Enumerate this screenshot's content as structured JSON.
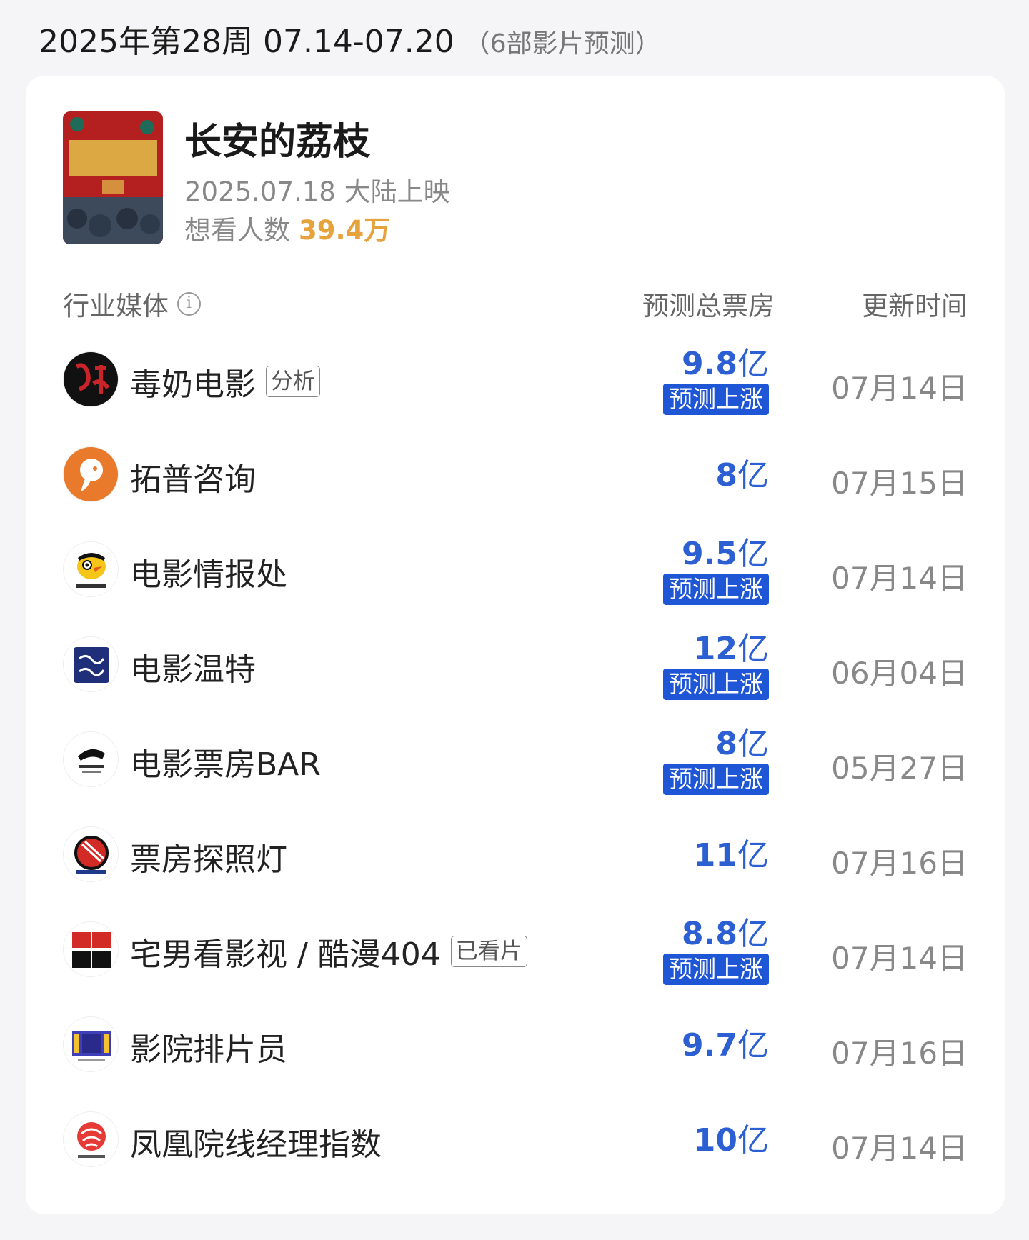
{
  "week": {
    "title": "2025年第28周 07.14-07.20",
    "subtitle": "（6部影片预测）"
  },
  "movie": {
    "title": "长安的荔枝",
    "release": "2025.07.18 大陆上映",
    "want_label": "想看人数",
    "want_count": "39.4万",
    "poster_icon": "movie-poster"
  },
  "table_header": {
    "media": "行业媒体",
    "box_office": "预测总票房",
    "update_time": "更新时间"
  },
  "colors": {
    "accent_blue": "#2c5fd1",
    "badge_blue": "#1e56d6",
    "want_orange": "#e6a23c"
  },
  "rows": [
    {
      "name": "毒奶电影",
      "tag": "分析",
      "value": "9.8",
      "unit": "亿",
      "badge": "预测上涨",
      "date": "07月14日",
      "logo": "dunai-logo-icon"
    },
    {
      "name": "拓普咨询",
      "tag": "",
      "value": "8",
      "unit": "亿",
      "badge": "",
      "date": "07月15日",
      "logo": "tuopu-logo-icon"
    },
    {
      "name": "电影情报处",
      "tag": "",
      "value": "9.5",
      "unit": "亿",
      "badge": "预测上涨",
      "date": "07月14日",
      "logo": "penguin-logo-icon"
    },
    {
      "name": "电影温特",
      "tag": "",
      "value": "12",
      "unit": "亿",
      "badge": "预测上涨",
      "date": "06月04日",
      "logo": "wente-logo-icon"
    },
    {
      "name": "电影票房BAR",
      "tag": "",
      "value": "8",
      "unit": "亿",
      "badge": "预测上涨",
      "date": "05月27日",
      "logo": "bar-logo-icon"
    },
    {
      "name": "票房探照灯",
      "tag": "",
      "value": "11",
      "unit": "亿",
      "badge": "",
      "date": "07月16日",
      "logo": "searchlight-logo-icon"
    },
    {
      "name": "宅男看影视 / 酷漫404",
      "tag": "已看片",
      "value": "8.8",
      "unit": "亿",
      "badge": "预测上涨",
      "date": "07月14日",
      "logo": "kuman-logo-icon"
    },
    {
      "name": "影院排片员",
      "tag": "",
      "value": "9.7",
      "unit": "亿",
      "badge": "",
      "date": "07月16日",
      "logo": "film-strip-logo-icon"
    },
    {
      "name": "凤凰院线经理指数",
      "tag": "",
      "value": "10",
      "unit": "亿",
      "badge": "",
      "date": "07月14日",
      "logo": "ifeng-logo-icon"
    }
  ]
}
